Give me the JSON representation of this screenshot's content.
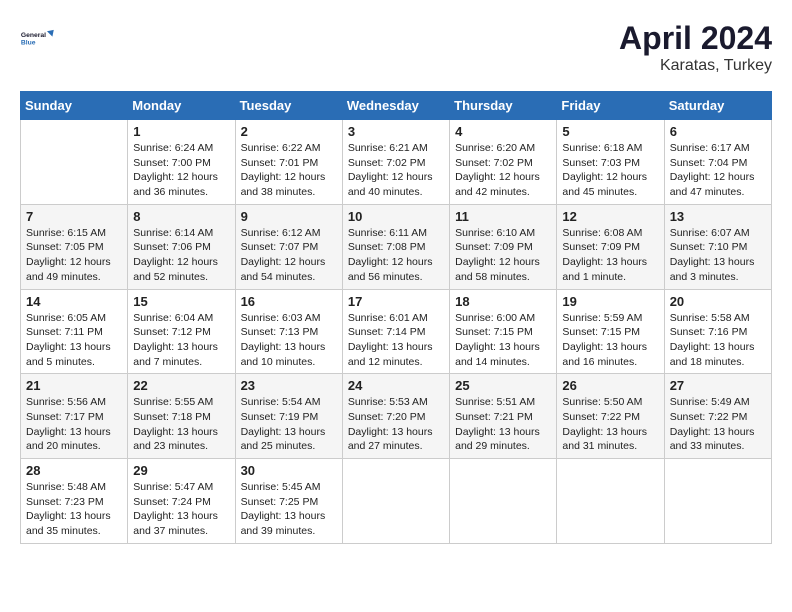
{
  "header": {
    "logo_line1": "General",
    "logo_line2": "Blue",
    "month": "April 2024",
    "location": "Karatas, Turkey"
  },
  "columns": [
    "Sunday",
    "Monday",
    "Tuesday",
    "Wednesday",
    "Thursday",
    "Friday",
    "Saturday"
  ],
  "weeks": [
    [
      {
        "num": "",
        "info": ""
      },
      {
        "num": "1",
        "info": "Sunrise: 6:24 AM\nSunset: 7:00 PM\nDaylight: 12 hours\nand 36 minutes."
      },
      {
        "num": "2",
        "info": "Sunrise: 6:22 AM\nSunset: 7:01 PM\nDaylight: 12 hours\nand 38 minutes."
      },
      {
        "num": "3",
        "info": "Sunrise: 6:21 AM\nSunset: 7:02 PM\nDaylight: 12 hours\nand 40 minutes."
      },
      {
        "num": "4",
        "info": "Sunrise: 6:20 AM\nSunset: 7:02 PM\nDaylight: 12 hours\nand 42 minutes."
      },
      {
        "num": "5",
        "info": "Sunrise: 6:18 AM\nSunset: 7:03 PM\nDaylight: 12 hours\nand 45 minutes."
      },
      {
        "num": "6",
        "info": "Sunrise: 6:17 AM\nSunset: 7:04 PM\nDaylight: 12 hours\nand 47 minutes."
      }
    ],
    [
      {
        "num": "7",
        "info": "Sunrise: 6:15 AM\nSunset: 7:05 PM\nDaylight: 12 hours\nand 49 minutes."
      },
      {
        "num": "8",
        "info": "Sunrise: 6:14 AM\nSunset: 7:06 PM\nDaylight: 12 hours\nand 52 minutes."
      },
      {
        "num": "9",
        "info": "Sunrise: 6:12 AM\nSunset: 7:07 PM\nDaylight: 12 hours\nand 54 minutes."
      },
      {
        "num": "10",
        "info": "Sunrise: 6:11 AM\nSunset: 7:08 PM\nDaylight: 12 hours\nand 56 minutes."
      },
      {
        "num": "11",
        "info": "Sunrise: 6:10 AM\nSunset: 7:09 PM\nDaylight: 12 hours\nand 58 minutes."
      },
      {
        "num": "12",
        "info": "Sunrise: 6:08 AM\nSunset: 7:09 PM\nDaylight: 13 hours\nand 1 minute."
      },
      {
        "num": "13",
        "info": "Sunrise: 6:07 AM\nSunset: 7:10 PM\nDaylight: 13 hours\nand 3 minutes."
      }
    ],
    [
      {
        "num": "14",
        "info": "Sunrise: 6:05 AM\nSunset: 7:11 PM\nDaylight: 13 hours\nand 5 minutes."
      },
      {
        "num": "15",
        "info": "Sunrise: 6:04 AM\nSunset: 7:12 PM\nDaylight: 13 hours\nand 7 minutes."
      },
      {
        "num": "16",
        "info": "Sunrise: 6:03 AM\nSunset: 7:13 PM\nDaylight: 13 hours\nand 10 minutes."
      },
      {
        "num": "17",
        "info": "Sunrise: 6:01 AM\nSunset: 7:14 PM\nDaylight: 13 hours\nand 12 minutes."
      },
      {
        "num": "18",
        "info": "Sunrise: 6:00 AM\nSunset: 7:15 PM\nDaylight: 13 hours\nand 14 minutes."
      },
      {
        "num": "19",
        "info": "Sunrise: 5:59 AM\nSunset: 7:15 PM\nDaylight: 13 hours\nand 16 minutes."
      },
      {
        "num": "20",
        "info": "Sunrise: 5:58 AM\nSunset: 7:16 PM\nDaylight: 13 hours\nand 18 minutes."
      }
    ],
    [
      {
        "num": "21",
        "info": "Sunrise: 5:56 AM\nSunset: 7:17 PM\nDaylight: 13 hours\nand 20 minutes."
      },
      {
        "num": "22",
        "info": "Sunrise: 5:55 AM\nSunset: 7:18 PM\nDaylight: 13 hours\nand 23 minutes."
      },
      {
        "num": "23",
        "info": "Sunrise: 5:54 AM\nSunset: 7:19 PM\nDaylight: 13 hours\nand 25 minutes."
      },
      {
        "num": "24",
        "info": "Sunrise: 5:53 AM\nSunset: 7:20 PM\nDaylight: 13 hours\nand 27 minutes."
      },
      {
        "num": "25",
        "info": "Sunrise: 5:51 AM\nSunset: 7:21 PM\nDaylight: 13 hours\nand 29 minutes."
      },
      {
        "num": "26",
        "info": "Sunrise: 5:50 AM\nSunset: 7:22 PM\nDaylight: 13 hours\nand 31 minutes."
      },
      {
        "num": "27",
        "info": "Sunrise: 5:49 AM\nSunset: 7:22 PM\nDaylight: 13 hours\nand 33 minutes."
      }
    ],
    [
      {
        "num": "28",
        "info": "Sunrise: 5:48 AM\nSunset: 7:23 PM\nDaylight: 13 hours\nand 35 minutes."
      },
      {
        "num": "29",
        "info": "Sunrise: 5:47 AM\nSunset: 7:24 PM\nDaylight: 13 hours\nand 37 minutes."
      },
      {
        "num": "30",
        "info": "Sunrise: 5:45 AM\nSunset: 7:25 PM\nDaylight: 13 hours\nand 39 minutes."
      },
      {
        "num": "",
        "info": ""
      },
      {
        "num": "",
        "info": ""
      },
      {
        "num": "",
        "info": ""
      },
      {
        "num": "",
        "info": ""
      }
    ]
  ]
}
